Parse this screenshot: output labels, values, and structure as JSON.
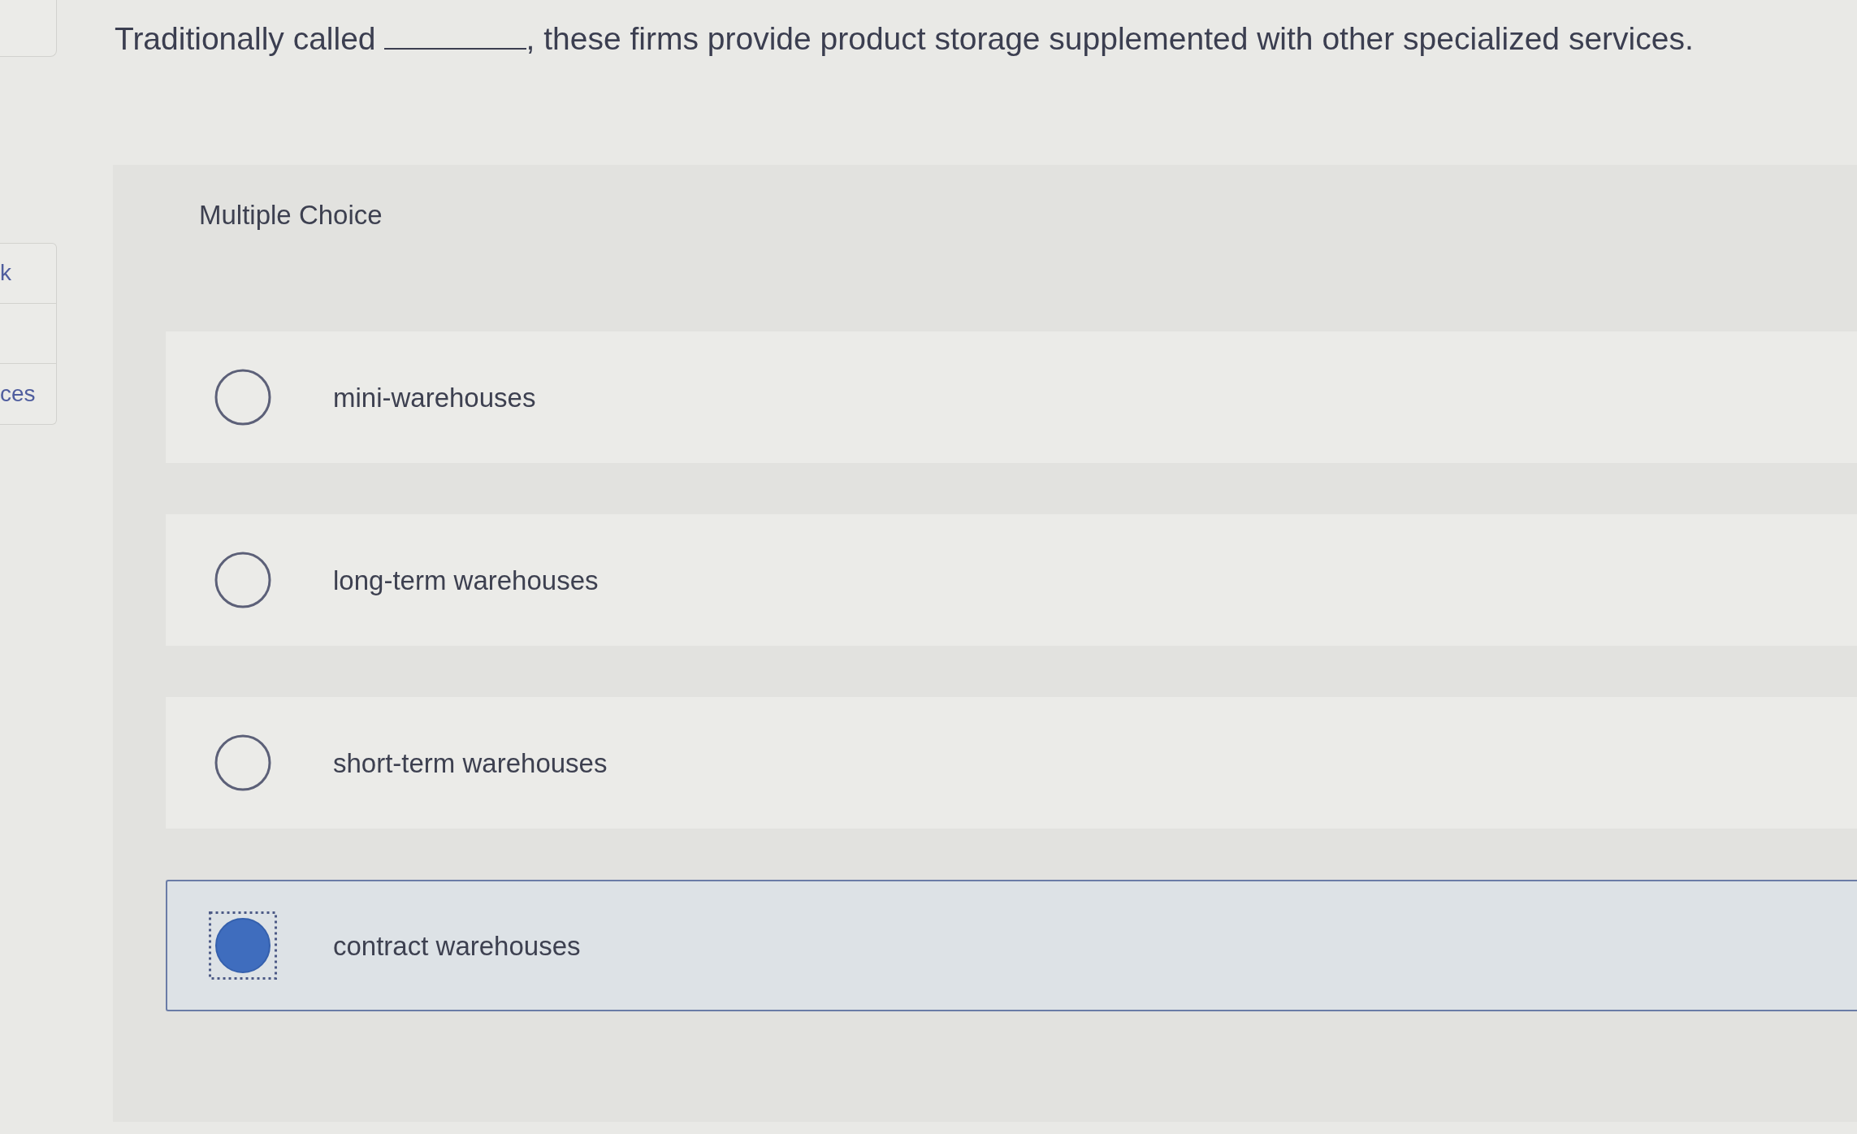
{
  "side_panel": {
    "items": [
      {
        "kind": "link",
        "label": "k"
      },
      {
        "kind": "blank"
      },
      {
        "kind": "link",
        "label": "ces"
      }
    ]
  },
  "question": {
    "text_before": "Traditionally called",
    "text_after": ", these firms provide product storage supplemented with other specialized services."
  },
  "card": {
    "type_label": "Multiple Choice",
    "options": [
      {
        "label": "mini-warehouses",
        "selected": false,
        "focused": false
      },
      {
        "label": "long-term warehouses",
        "selected": false,
        "focused": false
      },
      {
        "label": "short-term warehouses",
        "selected": false,
        "focused": false
      },
      {
        "label": "contract warehouses",
        "selected": true,
        "focused": true
      }
    ]
  }
}
